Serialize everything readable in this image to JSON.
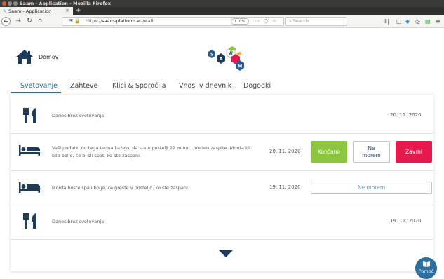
{
  "window": {
    "title": "Saam - Application - Mozilla Firefox"
  },
  "browser": {
    "tab_title": "Saam - Application",
    "tab_close": "×",
    "new_tab": "+",
    "url_prefix": "https://",
    "url_host": "saam-platform.eu",
    "url_path": "/wall",
    "zoom": "110%",
    "search_placeholder": "Search",
    "icons": {
      "back": "back-arrow-icon",
      "forward": "forward-arrow-icon",
      "reload": "reload-icon",
      "home": "home-icon",
      "shield": "shield-icon",
      "lock": "lock-icon",
      "more": "page-actions-icon",
      "pocket": "pocket-icon",
      "bookmark": "star-icon",
      "library": "library-icon",
      "sidebar": "sidebar-icon",
      "menu": "hamburger-menu-icon"
    }
  },
  "header": {
    "home_label": "Domov",
    "logo_letters": [
      "S",
      "A",
      "A",
      "M"
    ]
  },
  "tabs": [
    {
      "label": "Svetovanje",
      "active": true
    },
    {
      "label": "Zahteve",
      "active": false
    },
    {
      "label": "Klici & Sporočila",
      "active": false
    },
    {
      "label": "Vnosi v dnevnik",
      "active": false
    },
    {
      "label": "Dogodki",
      "active": false
    }
  ],
  "rows": [
    {
      "icon": "utensils-icon",
      "text": "Danes brez svetovanja",
      "date": "20. 11. 2020"
    },
    {
      "icon": "bed-icon",
      "text_line1": "Vaši podatki od tega tedna kažejo, da ste v postelji 22 minut, preden zaspite. Morda bi",
      "text_line2": "bilo bolje, če bi šli spat, ko ste zaspani.",
      "date": "20. 11. 2020",
      "actions": {
        "done": "Končano",
        "cannot_line1": "Ne",
        "cannot_line2": "morem",
        "close": "Zavrni"
      }
    },
    {
      "icon": "bed-icon",
      "text": "Morda boste spali bolje, če greste v posteljo, ko ste zaspani.",
      "date": "19. 11. 2020",
      "action": "Ne morem"
    },
    {
      "icon": "utensils-icon",
      "text": "Danes brez svetovanja",
      "date": "19. 11. 2020"
    }
  ],
  "help": {
    "label": "Pomoč"
  },
  "colors": {
    "primary": "#2c6e9c",
    "success": "#8cc63f",
    "danger": "#e6194f",
    "titlebar": "#3a3a38"
  }
}
